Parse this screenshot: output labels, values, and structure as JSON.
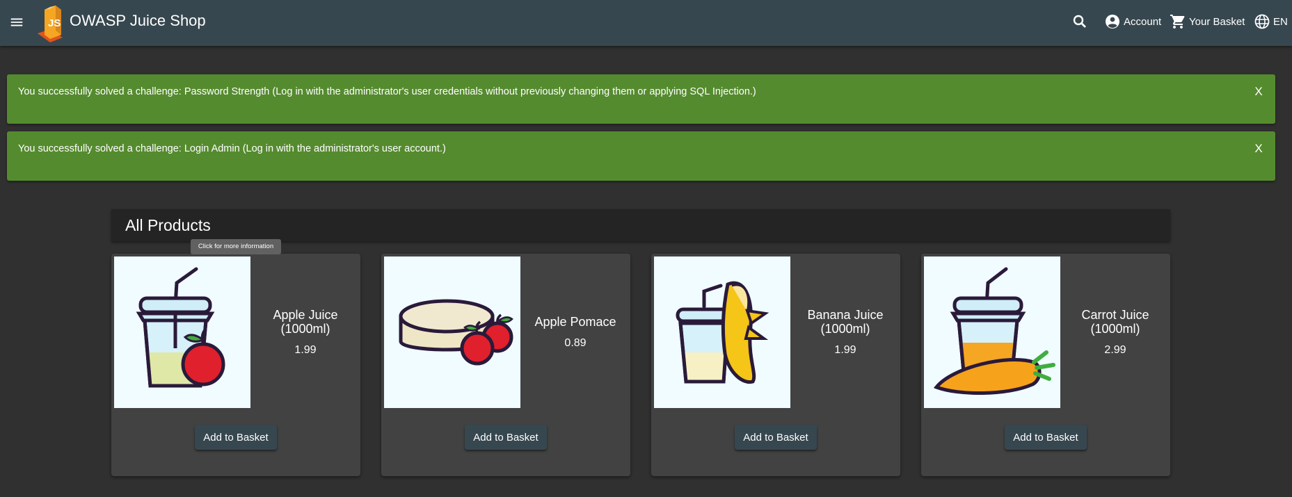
{
  "app": {
    "title": "OWASP Juice Shop"
  },
  "toolbar": {
    "account_label": "Account",
    "basket_label": "Your Basket",
    "language_label": "EN"
  },
  "banners": [
    {
      "text": "You successfully solved a challenge: Password Strength (Log in with the administrator's user credentials without previously changing them or applying SQL Injection.)",
      "close": "X"
    },
    {
      "text": "You successfully solved a challenge: Login Admin (Log in with the administrator's user account.)",
      "close": "X"
    }
  ],
  "products_section": {
    "title": "All Products"
  },
  "tooltip": {
    "text": "Click for more information"
  },
  "products": [
    {
      "name": "Apple Juice (1000ml)",
      "price": "1.99",
      "button": "Add to Basket",
      "image": "apple-juice"
    },
    {
      "name": "Apple Pomace",
      "price": "0.89",
      "button": "Add to Basket",
      "image": "apple-pomace"
    },
    {
      "name": "Banana Juice (1000ml)",
      "price": "1.99",
      "button": "Add to Basket",
      "image": "banana-juice"
    },
    {
      "name": "Carrot Juice (1000ml)",
      "price": "2.99",
      "button": "Add to Basket",
      "image": "carrot-juice"
    }
  ],
  "colors": {
    "toolbar": "#37474f",
    "background": "#303030",
    "banner_success": "#558b2f",
    "card": "#424242",
    "image_bg": "#f0fcff"
  },
  "icons": [
    "menu-icon",
    "juice-shop-logo",
    "search-icon",
    "account-icon",
    "cart-icon",
    "language-icon"
  ]
}
